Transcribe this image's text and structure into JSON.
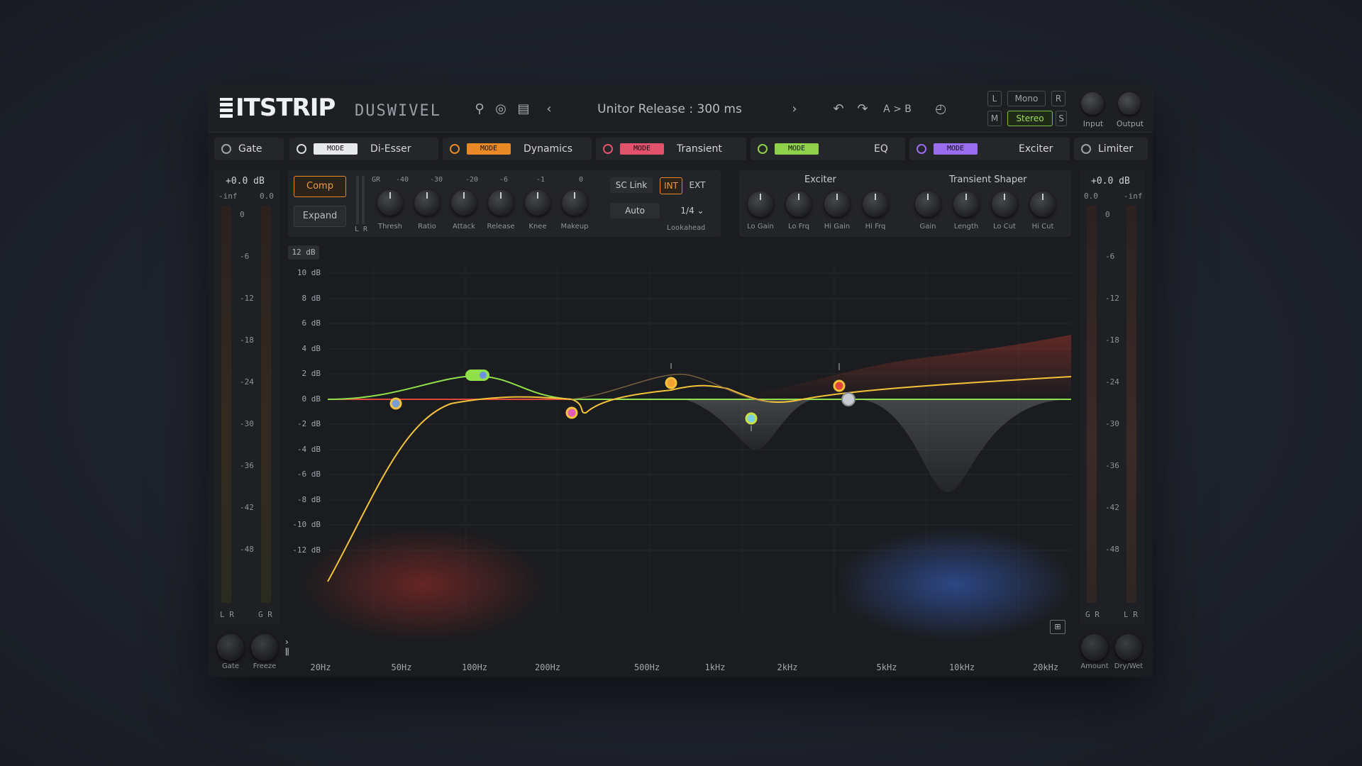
{
  "header": {
    "logo": "ITSTRIP",
    "preset_name": "DUSWIVEL",
    "preset_display": "Unitor Release : 300 ms",
    "ab_label": "A > B",
    "mode_box": "Mono",
    "left_box": "L",
    "right_box": "R",
    "mid_box": "M",
    "side_box": "S",
    "stereo_box": "Stereo",
    "knob_in_label": "Input",
    "knob_out_label": "Output"
  },
  "tabs": [
    {
      "label": "Gate",
      "tag": "",
      "tag_color": ""
    },
    {
      "label": "Di-Esser",
      "tag": "MODE",
      "tag_color": "#e8e9ec"
    },
    {
      "label": "Dynamics",
      "tag": "MODE",
      "tag_color": "#e98a26"
    },
    {
      "label": "Transient",
      "tag": "MODE",
      "tag_color": "#e2526d"
    },
    {
      "label": "EQ",
      "tag": "MODE",
      "tag_color": "#8fd14a"
    },
    {
      "label": "Exciter",
      "tag": "MODE",
      "tag_color": "#9a6cf0"
    },
    {
      "label": "Limiter",
      "tag": "",
      "tag_color": ""
    }
  ],
  "meters": {
    "left_readout": "+0.0 dB",
    "left_sub_a": "-inf",
    "left_sub_b": "0.0",
    "right_readout": "+0.0 dB",
    "right_sub_a": "0.0",
    "right_sub_b": "-inf",
    "scale_left": [
      "0",
      "-6",
      "-12",
      "-18",
      "-24",
      "-30",
      "-36",
      "-42",
      "-48"
    ],
    "scale_right": [
      "0",
      "-6",
      "-12",
      "-18",
      "-24",
      "-30",
      "-36",
      "-42",
      "-48"
    ],
    "left_lr": "L R",
    "left_gr": "G R",
    "right_gr": "G R",
    "right_lr": "L R"
  },
  "dynamics": {
    "mode_compress": "Comp",
    "mode_expand": "Expand",
    "scale": [
      "GR",
      "-40",
      "-30",
      "-20",
      "-6",
      "-1",
      "0"
    ],
    "knob_labels": [
      "Thresh",
      "Ratio",
      "Attack",
      "Release",
      "Knee",
      "Makeup"
    ],
    "lr_label": "L R",
    "sidechain": "SC Link",
    "int": "INT",
    "ext": "EXT",
    "auto": "Auto",
    "rate": "1/4",
    "rate_label": "Lookahead"
  },
  "exciter": {
    "title": "Exciter",
    "knobs": [
      "Lo Gain",
      "Lo Frq",
      "Hi Gain",
      "Hi Frq"
    ]
  },
  "transient": {
    "title": "Transient Shaper",
    "knobs": [
      "Gain",
      "Length",
      "Lo Cut",
      "Hi Cut"
    ]
  },
  "eq": {
    "resolution": "12 dB",
    "db_labels": [
      "10 dB",
      "8 dB",
      "6 dB",
      "4 dB",
      "2 dB",
      "0 dB",
      "-2 dB",
      "-4 dB",
      "-6 dB",
      "-8 dB",
      "-10 dB",
      "-12 dB"
    ],
    "freq_labels": [
      "20Hz",
      "50Hz",
      "100Hz",
      "200Hz",
      "500Hz",
      "1kHz",
      "2kHz",
      "5kHz",
      "10kHz",
      "20kHz"
    ],
    "bottom_knob_labels": [
      "Gate",
      "Freeze",
      "Amount",
      "Dry/Wet"
    ],
    "curve_colors": {
      "yellow": "#f2c23a",
      "green": "#8fe04a",
      "red": "#e0473c",
      "gray": "#8a8e94"
    },
    "nodes": [
      {
        "name": "band-1-node",
        "color": "#7a9bd6",
        "ring": "#f2c23a"
      },
      {
        "name": "band-2-node",
        "color": "#6f8fe0",
        "ring": "#8fe04a"
      },
      {
        "name": "band-3-node",
        "color": "#e35ab8",
        "ring": "#f2c23a"
      },
      {
        "name": "band-4-node",
        "color": "#f2a030",
        "ring": "#f2c23a"
      },
      {
        "name": "band-5-node",
        "color": "#7ad0e0",
        "ring": "#c9e040"
      },
      {
        "name": "band-6-node",
        "color": "#e0473c",
        "ring": "#f2c23a"
      },
      {
        "name": "band-7-node",
        "color": "#c8cbd0",
        "ring": "#8a8e94"
      }
    ]
  }
}
